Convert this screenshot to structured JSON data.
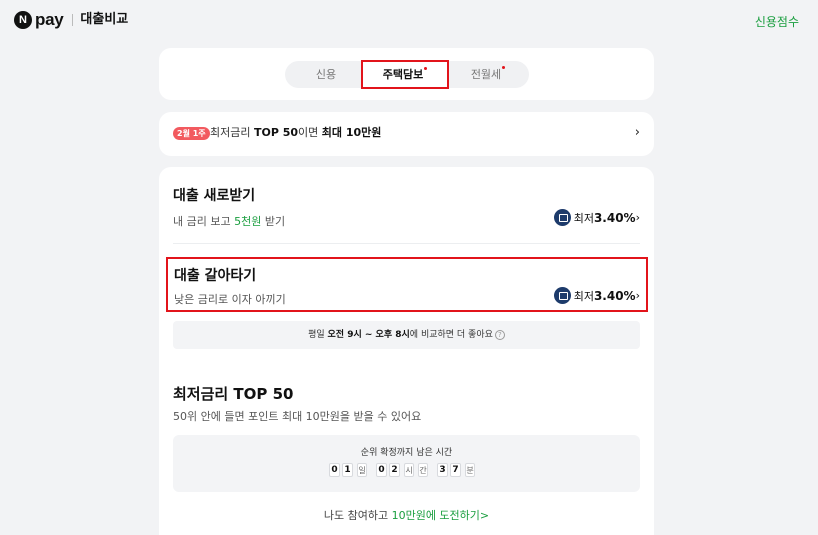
{
  "header": {
    "logo_n": "N",
    "logo_pay": "pay",
    "page_name": "대출비교",
    "credit_link": "신용점수"
  },
  "tabs": {
    "items": [
      {
        "label": "신용",
        "dot": false
      },
      {
        "label": "주택담보",
        "dot": true,
        "selected": true
      },
      {
        "label": "전월세",
        "dot": true
      }
    ]
  },
  "promo": {
    "badge": "2월 1주",
    "text_pre": "최저금리 ",
    "text_bold1": "TOP 50",
    "text_mid": "이면 ",
    "text_bold2": "최대 10만원"
  },
  "new_loan": {
    "title": "대출 새로받기",
    "sub_pre": "내 금리 보고 ",
    "sub_highlight": "5천원",
    "sub_post": " 받기",
    "rate_label": "최저",
    "rate_value": "3.40%"
  },
  "refinance": {
    "title": "대출 갈아타기",
    "sub": "낮은 금리로 이자 아끼기",
    "rate_label": "최저",
    "rate_value": "3.40%"
  },
  "info_bar": {
    "pre": "평일 ",
    "bold1": "오전 9시 ~ 오후 8시",
    "post": "에 비교하면 더 좋아요"
  },
  "top50": {
    "title": "최저금리 TOP 50",
    "sub": "50위 안에 들면 포인트 최대 10만원을 받을 수 있어요",
    "timer_label": "순위 확정까지 남은 시간",
    "timer": {
      "day_digits": [
        "0",
        "1"
      ],
      "day_unit": "일",
      "hour_digits": [
        "0",
        "2"
      ],
      "hour_unit1": "시",
      "hour_unit2": "간",
      "min_digits": [
        "3",
        "7"
      ],
      "min_unit": "분"
    },
    "challenge_pre": "나도 참여하고 ",
    "challenge_link": "10만원에 도전하기",
    "challenge_arrow": ">"
  },
  "colors": {
    "accent_green": "#1a9e3f",
    "highlight_red": "#e2141b",
    "badge_red": "#f25a5f",
    "rate_icon_navy": "#1d3b6b"
  }
}
